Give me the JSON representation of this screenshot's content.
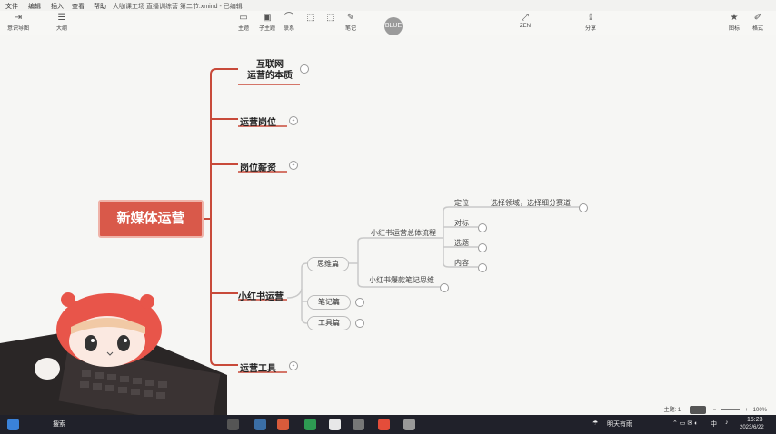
{
  "menu": {
    "file": "文件",
    "edit": "编辑",
    "insert": "插入",
    "view": "查看",
    "help": "帮助",
    "doc_title": "大咖课工场 直播训练营 第二节.xmind - 已编辑"
  },
  "toolbar": {
    "left_items": [
      "意识导图",
      "大纲"
    ],
    "mid_items": [
      "主题",
      "子主题",
      "联系",
      "",
      "",
      "笔记"
    ],
    "zen": "ZEN",
    "share": "分享",
    "right_items": [
      "图标",
      "格式"
    ],
    "avatar": "BLUE"
  },
  "mindmap": {
    "root": "新媒体运营",
    "branches": [
      {
        "label": "互联网\n运营的本质",
        "fold": ""
      },
      {
        "label": "运营岗位",
        "fold": "+"
      },
      {
        "label": "岗位薪资",
        "fold": "+"
      },
      {
        "label": "小红书运营",
        "fold": ""
      },
      {
        "label": "运营工具",
        "fold": "+"
      }
    ],
    "xhs": {
      "pills": [
        "思维篇",
        "笔记篇",
        "工具篇"
      ],
      "sub1": "小红书运营总体流程",
      "sub2": "小红书爆款笔记思维",
      "leaves": [
        "定位",
        "对标",
        "选题",
        "内容"
      ],
      "positioning_detail": "选择领域，选择细分赛道"
    },
    "colors": {
      "root": "#d9594a",
      "branch_line": "#c84a3a",
      "sub_line": "#c9c9c9"
    }
  },
  "statusbar": {
    "topics": "主题: 1",
    "zoom": "100%"
  },
  "taskbar": {
    "search": "搜索",
    "weather": "明天有雨",
    "lang": "中",
    "time": "15:23",
    "date": "2023/6/22"
  }
}
